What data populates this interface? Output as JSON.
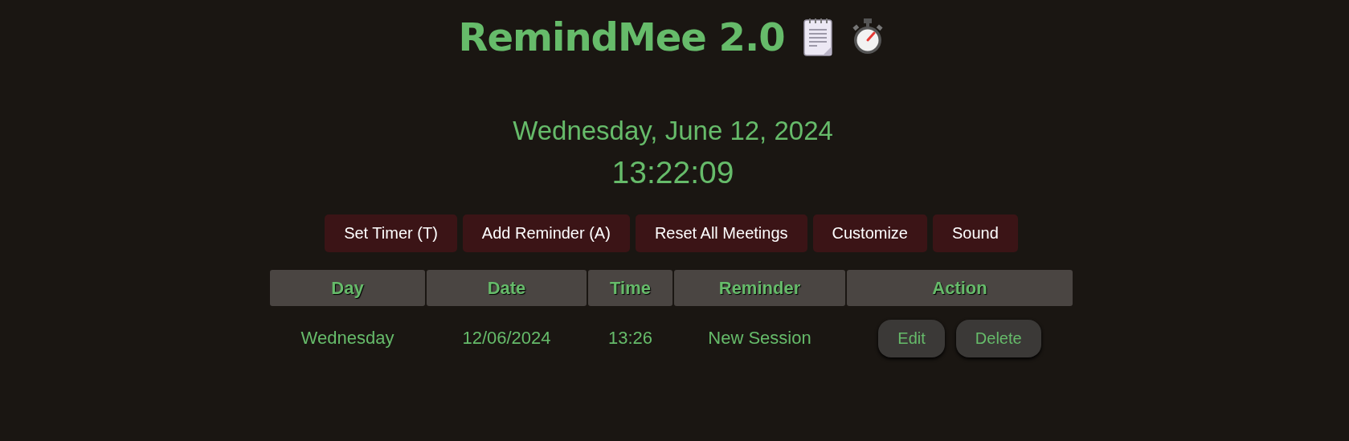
{
  "app": {
    "title": "RemindMee 2.0"
  },
  "clock": {
    "date": "Wednesday, June 12, 2024",
    "time": "13:22:09"
  },
  "toolbar": {
    "buttons": [
      "Set Timer (T)",
      "Add Reminder (A)",
      "Reset All Meetings",
      "Customize",
      "Sound"
    ]
  },
  "table": {
    "columns": [
      "Day",
      "Date",
      "Time",
      "Reminder",
      "Action"
    ],
    "rows": [
      {
        "day": "Wednesday",
        "date": "12/06/2024",
        "time": "13:26",
        "reminder": "New Session",
        "actions": [
          "Edit",
          "Delete"
        ]
      }
    ]
  }
}
